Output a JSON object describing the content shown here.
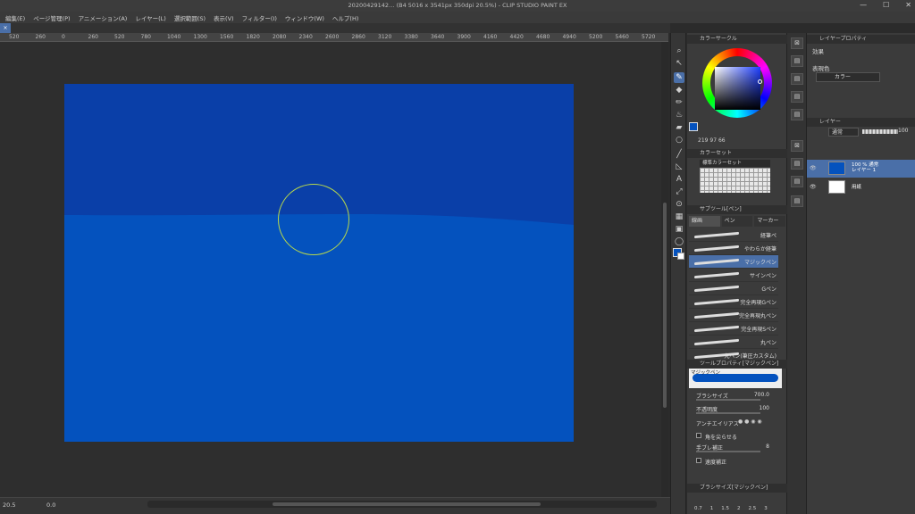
{
  "window": {
    "title": "20200429142… (B4 5016 x 3541px 350dpi 20.5%) - CLIP STUDIO PAINT EX",
    "controls": [
      "—",
      "☐",
      "✕"
    ]
  },
  "menu": [
    "編集(E)",
    "ページ管理(P)",
    "アニメーション(A)",
    "レイヤー(L)",
    "選択範囲(S)",
    "表示(V)",
    "フィルター(I)",
    "ウィンドウ(W)",
    "ヘルプ(H)"
  ],
  "ruler_labels": [
    "520",
    "260",
    "0",
    "260",
    "520",
    "780",
    "1040",
    "1300",
    "1560",
    "1820",
    "2080",
    "2340",
    "2600",
    "2860",
    "3120",
    "3380",
    "3640",
    "3900",
    "4160",
    "4420",
    "4680",
    "4940",
    "5200",
    "5460",
    "5720"
  ],
  "canvas": {
    "paper_color": "#0452be",
    "upper_color": "#0a3fa8"
  },
  "status": {
    "zoom": "20.5",
    "rotation": "0.0"
  },
  "color_wheel": {
    "title": "カラーサークル",
    "h": "219",
    "s": "97",
    "v": "66",
    "main_color": "#0452be",
    "sub_color": "#ffffff"
  },
  "color_set": {
    "title": "カラーセット",
    "name": "標準カラーセット"
  },
  "subtool": {
    "title": "サブツール[ペン]",
    "tabs": [
      "線画",
      "ペン",
      "マーカー"
    ],
    "brushes": [
      "経筆ペ",
      "やわらか経筆",
      "マジックペン",
      "サインペン",
      "Gペン",
      "完全再現Gペン",
      "完全再現丸ペン",
      "完全再現Sペン",
      "丸ペン",
      "丸ペン(筆圧カスタム)"
    ],
    "selected": 2
  },
  "tool_property": {
    "title": "ツールプロパティ[マジックペン]",
    "preview_label": "マジックペン",
    "brush_size_label": "ブラシサイズ",
    "brush_size": "700.0",
    "opacity_label": "不透明度",
    "opacity": "100",
    "antialias_label": "アンチエイリアス",
    "corner_label": "角を尖らせる",
    "stabilization_label": "手ブレ補正",
    "stabilization": "8",
    "speed_label": "速度補正"
  },
  "brush_size_panel": {
    "title": "ブラシサイズ[マジックペン]",
    "sizes": [
      "0.7",
      "1",
      "1.5",
      "2",
      "2.5",
      "3"
    ]
  },
  "layer_property": {
    "title": "レイヤープロパティ",
    "effect_label": "効果",
    "expression_label": "表現色",
    "expression_value": "カラー"
  },
  "layers": {
    "title": "レイヤー",
    "blend_mode": "通常",
    "opacity": "100",
    "items": [
      {
        "line1": "100 % 通常",
        "line2": "レイヤー 1",
        "thumb": "#0452be",
        "selected": true
      },
      {
        "line1": "",
        "line2": "用紙",
        "thumb": "#ffffff",
        "selected": false
      }
    ]
  }
}
